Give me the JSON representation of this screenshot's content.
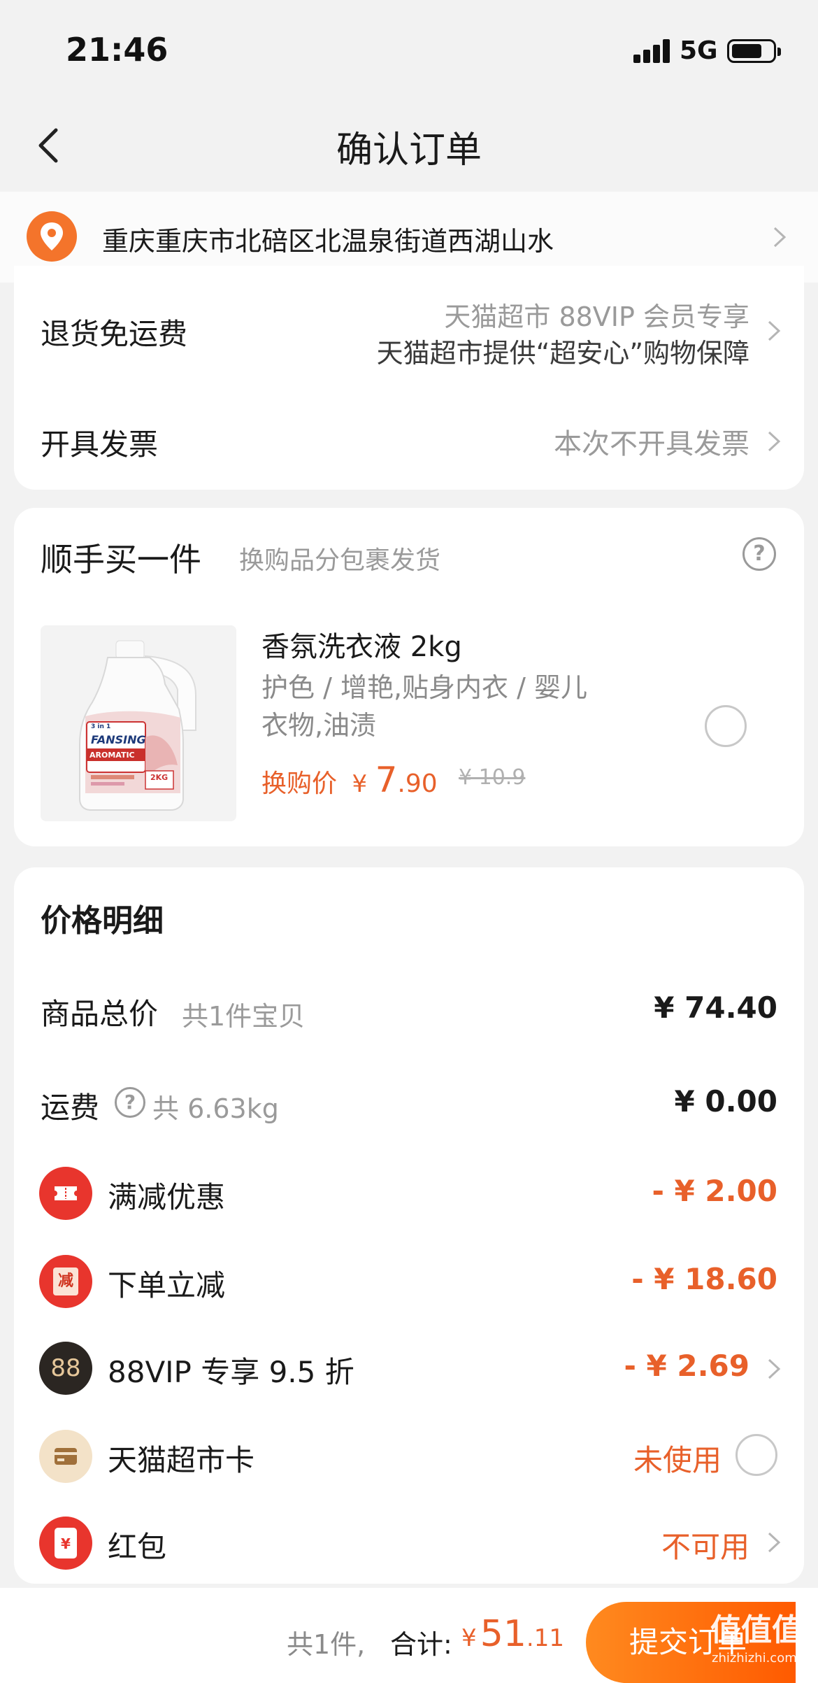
{
  "status": {
    "time": "21:46",
    "network": "5G"
  },
  "nav": {
    "title": "确认订单"
  },
  "address": {
    "text": "重庆重庆市北碚区北温泉街道西湖山水"
  },
  "service": {
    "return_label": "退货免运费",
    "return_line1": "天猫超市 88VIP 会员专享",
    "return_line2": "天猫超市提供“超安心”购物保障",
    "invoice_label": "开具发票",
    "invoice_value": "本次不开具发票"
  },
  "addon": {
    "title": "顺手买一件",
    "subtitle": "换购品分包裹发货",
    "product": {
      "name": "香氛洗衣液 2kg",
      "desc_line1": "护色 / 增艳,贴身内衣 / 婴儿",
      "desc_line2": "衣物,油渍",
      "price_label": "换购价",
      "currency": "¥",
      "price_int": "7",
      "price_dec": ".90",
      "original_price": "¥ 10.9",
      "bottle_brand": "FANSING",
      "bottle_sub": "AROMATIC",
      "bottle_weight": "2KG"
    }
  },
  "price_detail": {
    "title": "价格明细",
    "rows": [
      {
        "label": "商品总价",
        "sub": "共1件宝贝",
        "value": "¥ 74.40"
      },
      {
        "label": "运费",
        "sub": "共 6.63kg",
        "value": "¥ 0.00"
      },
      {
        "label": "满减优惠",
        "value": "- ¥ 2.00",
        "icon": "ticket-icon"
      },
      {
        "label": "下单立减",
        "value": "- ¥ 18.60",
        "icon": "discount-icon",
        "icon_text": "减"
      },
      {
        "label": "88VIP 专享 9.5 折",
        "value": "- ¥ 2.69",
        "icon": "vip-icon",
        "icon_text": "88"
      },
      {
        "label": "天猫超市卡",
        "value": "未使用",
        "icon": "card-icon"
      },
      {
        "label": "红包",
        "value": "不可用",
        "icon": "red-packet-icon",
        "icon_text": "¥"
      }
    ]
  },
  "bottom": {
    "count": "共1件,",
    "total_label": "合计:",
    "currency": "¥",
    "total_int": "51",
    "total_dec": ".11",
    "submit": "提交订单",
    "watermark": "值值值",
    "watermark_url": "zhizhizhi.com"
  },
  "colors": {
    "accent": "#e8602a",
    "button": "#ff6a00",
    "red_badge": "#e8352d"
  }
}
